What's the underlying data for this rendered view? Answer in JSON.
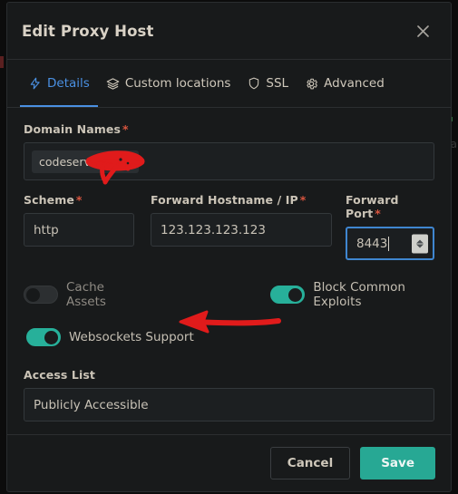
{
  "window": {
    "title": "Edit Proxy Host",
    "close_icon": "close-icon"
  },
  "tabs": [
    {
      "label": "Details",
      "icon": "lightning-bolt-icon",
      "active": true
    },
    {
      "label": "Custom locations",
      "icon": "layers-icon",
      "active": false
    },
    {
      "label": "SSL",
      "icon": "shield-icon",
      "active": false
    },
    {
      "label": "Advanced",
      "icon": "gear-icon",
      "active": false
    }
  ],
  "form": {
    "domain_names": {
      "label": "Domain Names",
      "required_marker": "*",
      "chip_value": "codeserver.",
      "redacted": true
    },
    "scheme": {
      "label": "Scheme",
      "required_marker": "*",
      "value": "http"
    },
    "forward_hostname": {
      "label": "Forward Hostname / IP",
      "required_marker": "*",
      "value": "123.123.123.123"
    },
    "forward_port": {
      "label": "Forward Port",
      "required_marker": "*",
      "value": "8443",
      "focused": true,
      "spinner_up_icon": "chevron-up-icon",
      "spinner_down_icon": "chevron-down-icon"
    },
    "toggles": [
      {
        "label": "Cache Assets",
        "on": false
      },
      {
        "label": "Block Common Exploits",
        "on": true
      },
      {
        "label": "Websockets Support",
        "on": true
      }
    ],
    "access_list": {
      "label": "Access List",
      "value": "Publicly Accessible"
    }
  },
  "footer": {
    "cancel_label": "Cancel",
    "save_label": "Save"
  },
  "backdrop": {
    "ghost_text": "a"
  },
  "colors": {
    "accent_teal": "#27a894",
    "accent_blue": "#4a90e2",
    "required_red": "#d9553f",
    "annotation_red": "#e01b1b",
    "modal_bg": "#181a1b",
    "page_bg": "#0c0c0c"
  }
}
